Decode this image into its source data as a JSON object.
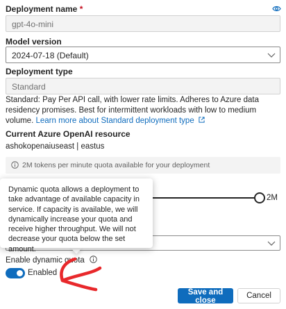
{
  "deployment_name": {
    "label": "Deployment name",
    "required_marker": "*",
    "value": "gpt-4o-mini"
  },
  "model_version": {
    "label": "Model version",
    "selected": "2024-07-18 (Default)"
  },
  "deployment_type": {
    "label": "Deployment type",
    "value": "Standard",
    "description": "Standard: Pay Per API call, with lower rate limits. Adheres to Azure data residency promises. Best for intermittent workloads with low to medium volume.",
    "learn_more_link": "Learn more about Standard deployment type"
  },
  "resource": {
    "label": "Current Azure OpenAI resource",
    "value": "ashokopenaiuseast | eastus"
  },
  "quota_info": "2M tokens per minute quota available for your deployment",
  "rate_limit": {
    "value_label": "2M",
    "level": 1.0
  },
  "tooltip": {
    "text": "Dynamic quota allows a deployment to take advantage of available capacity in service. If capacity is available, we will dynamically increase your quota and receive higher throughput. We will not decrease your quota below the set amount."
  },
  "dynamic_quota": {
    "label": "Enable dynamic quota",
    "toggle_state": "Enabled",
    "on": true
  },
  "buttons": {
    "save": "Save and close",
    "cancel": "Cancel"
  },
  "icons": {
    "top_right": "eye-icon",
    "info": "info-icon",
    "external": "external-link-icon",
    "chevron": "chevron-down-icon"
  },
  "colors": {
    "accent": "#0f6cbd",
    "required": "#c50f1f",
    "annotation": "#e8282b"
  }
}
